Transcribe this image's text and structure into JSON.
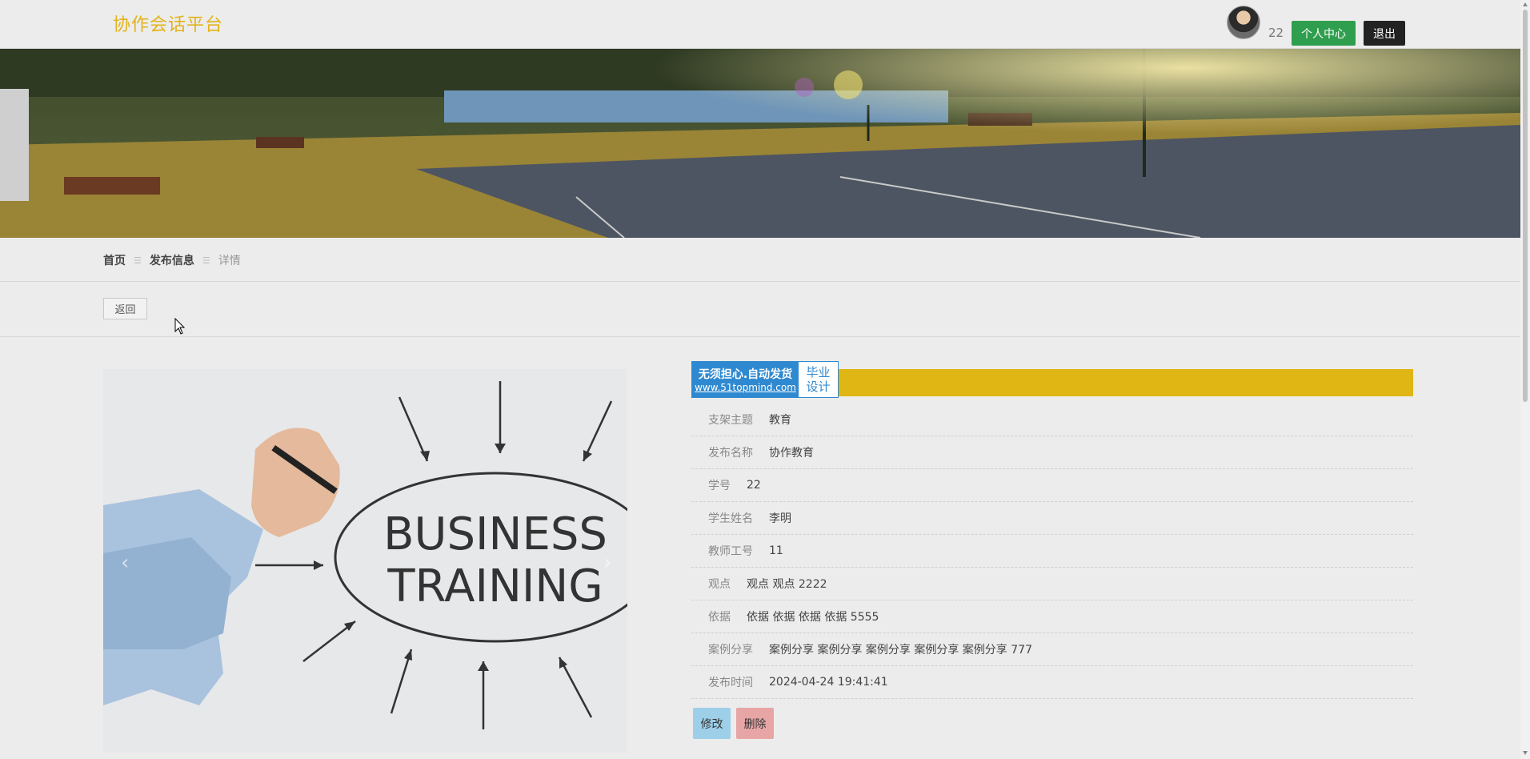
{
  "header": {
    "brand": "协作会话平台",
    "user_id": "22",
    "profile_label": "个人中心",
    "logout_label": "退出"
  },
  "breadcrumb": {
    "items": [
      "首页",
      "发布信息",
      "详情"
    ],
    "separator": "☰"
  },
  "actions": {
    "back_label": "返回"
  },
  "watermark": {
    "line1": "无须担心.自动发货",
    "line2": "www.51topmind.com",
    "right_line1": "毕业",
    "right_line2": "设计"
  },
  "image_text": {
    "line1": "BUSINESS",
    "line2": "TRAINING"
  },
  "details": [
    {
      "label": "支架主题",
      "value": "教育"
    },
    {
      "label": "发布名称",
      "value": "协作教育"
    },
    {
      "label": "学号",
      "value": "22"
    },
    {
      "label": "学生姓名",
      "value": "李明"
    },
    {
      "label": "教师工号",
      "value": "11"
    },
    {
      "label": "观点",
      "value": "观点 观点 2222"
    },
    {
      "label": "依据",
      "value": "依据 依据 依据 依据 5555"
    },
    {
      "label": "案例分享",
      "value": "案例分享 案例分享 案例分享 案例分享 案例分享 777"
    },
    {
      "label": "发布时间",
      "value": "2024-04-24 19:41:41"
    }
  ],
  "buttons": {
    "edit_label": "修改",
    "delete_label": "删除"
  },
  "colors": {
    "brand": "#e2b31a",
    "profile_button": "#2f9e4e",
    "logout_button": "#222222",
    "title_bar": "#dfb614",
    "edit_button": "#9dcfe9",
    "delete_button": "#e7a5a5"
  },
  "banner": {
    "slide_count": 3,
    "active_slide": 1
  }
}
